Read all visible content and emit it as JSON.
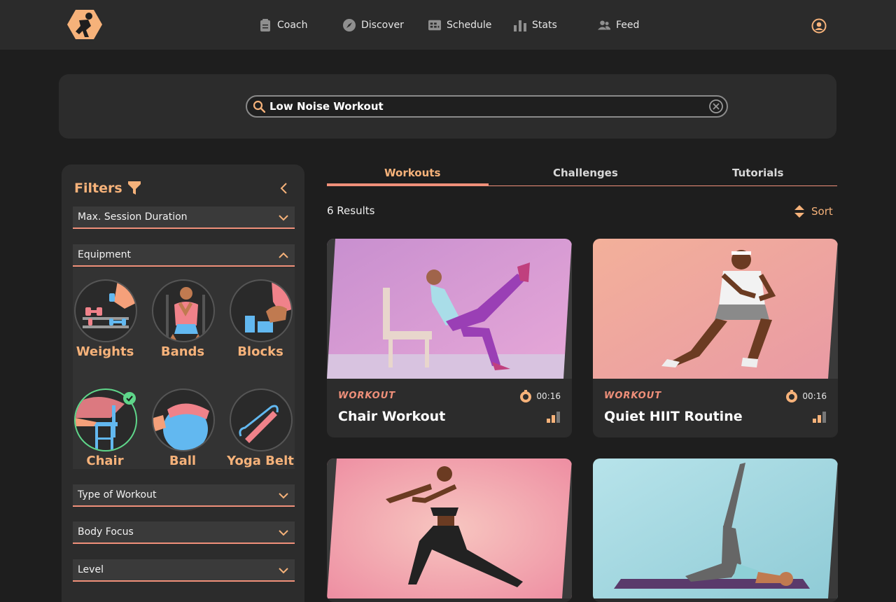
{
  "nav": {
    "items": [
      {
        "label": "Coach",
        "icon": "clipboard-icon"
      },
      {
        "label": "Discover",
        "icon": "compass-icon"
      },
      {
        "label": "Schedule",
        "icon": "calendar-icon"
      },
      {
        "label": "Stats",
        "icon": "bar-chart-icon"
      },
      {
        "label": "Feed",
        "icon": "people-icon"
      }
    ]
  },
  "search": {
    "value": "Low Noise Workout"
  },
  "filters": {
    "title": "Filters",
    "dropdowns": {
      "duration": "Max. Session Duration",
      "equipment": "Equipment",
      "type": "Type of Workout",
      "body": "Body Focus",
      "level": "Level"
    },
    "equipment": [
      {
        "label": "Weights",
        "selected": false
      },
      {
        "label": "Bands",
        "selected": false
      },
      {
        "label": "Blocks",
        "selected": false
      },
      {
        "label": "Chair",
        "selected": true
      },
      {
        "label": "Ball",
        "selected": false
      },
      {
        "label": "Yoga Belt",
        "selected": false
      }
    ]
  },
  "tabs": [
    {
      "label": "Workouts",
      "active": true
    },
    {
      "label": "Challenges",
      "active": false
    },
    {
      "label": "Tutorials",
      "active": false
    }
  ],
  "results_label": "6 Results",
  "sort_label": "Sort",
  "cards": [
    {
      "type": "WORKOUT",
      "title": "Chair Workout",
      "duration": "00:16",
      "level_bars": 2
    },
    {
      "type": "WORKOUT",
      "title": "Quiet HIIT Routine",
      "duration": "00:16",
      "level_bars": 2
    }
  ],
  "colors": {
    "accent": "#f6b27a",
    "underline": "#f0907a",
    "selected": "#5fd68a",
    "panel": "#2c2c2c",
    "background": "#1e1e1e"
  }
}
